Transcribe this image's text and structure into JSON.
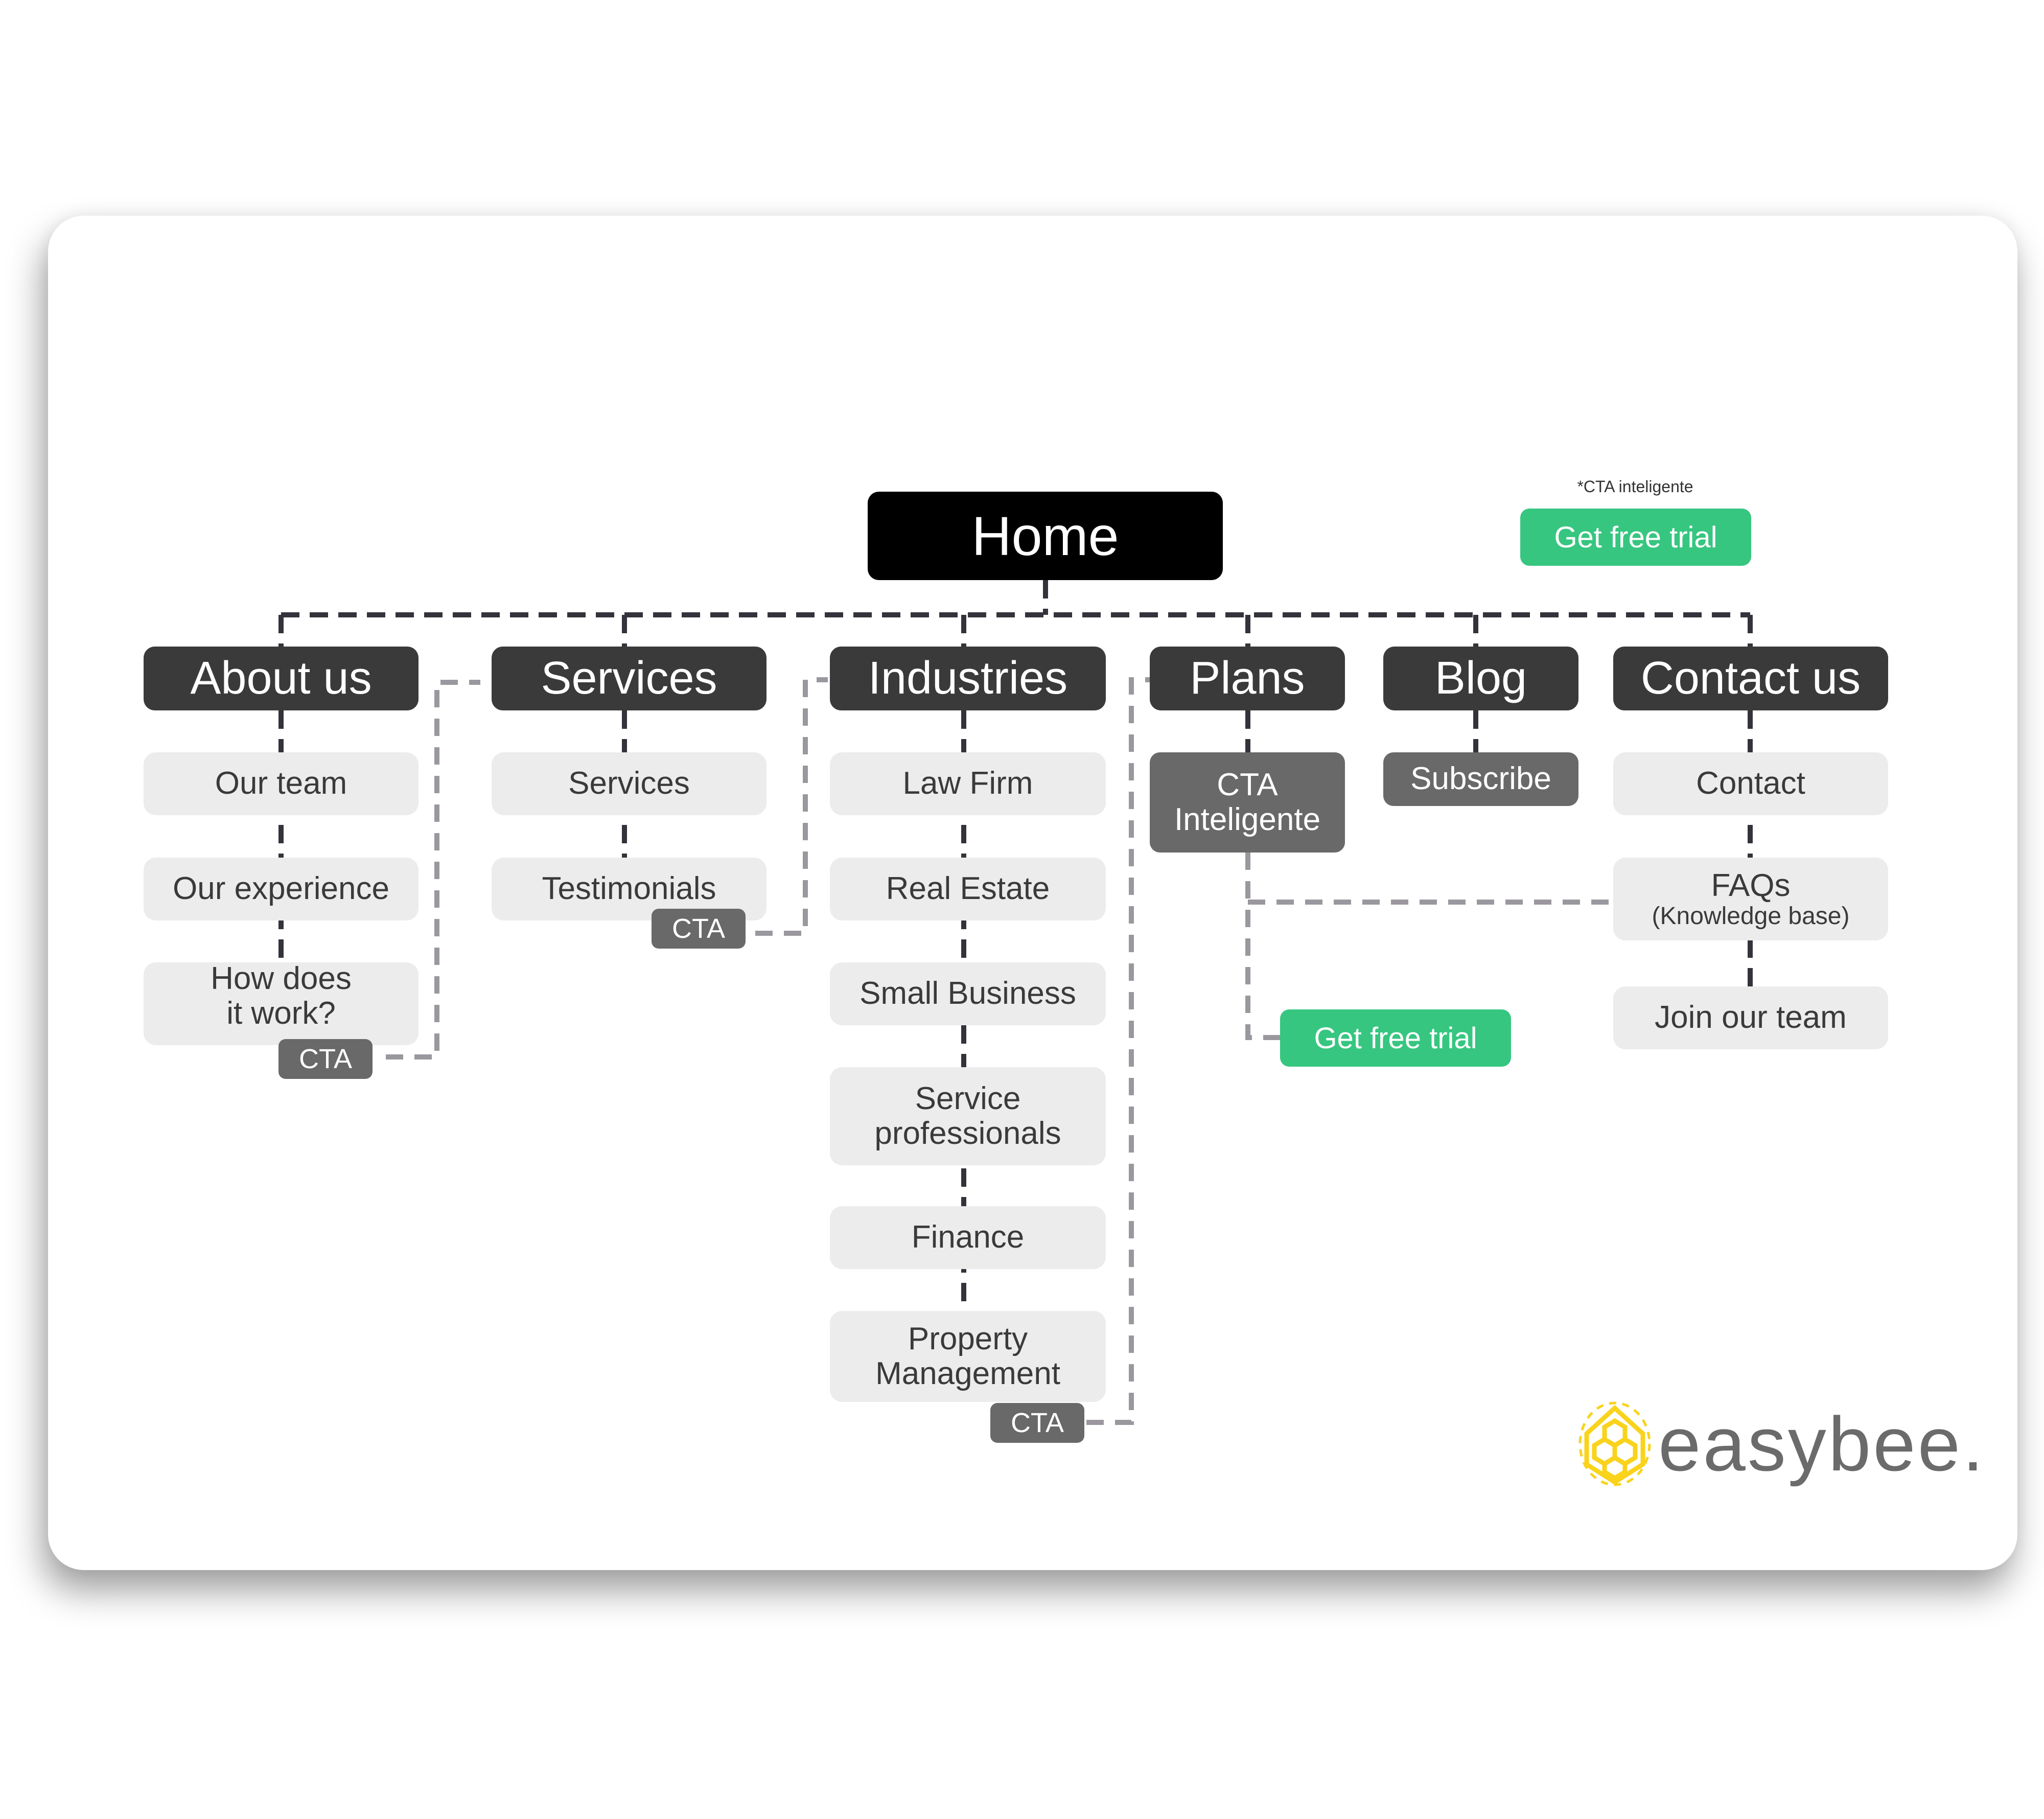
{
  "diagram": {
    "root": "Home",
    "legend": {
      "note": "*CTA inteligente",
      "button": "Get free trial"
    },
    "columns": [
      {
        "label": "About us",
        "children": [
          "Our team",
          "Our experience",
          "How does it work?"
        ],
        "cta": "CTA"
      },
      {
        "label": "Services",
        "children": [
          "Services",
          "Testimonials"
        ],
        "cta": "CTA"
      },
      {
        "label": "Industries",
        "children": [
          "Law Firm",
          "Real Estate",
          "Small Business",
          "Service professionals",
          "Finance",
          "Property Management"
        ],
        "cta": "CTA"
      },
      {
        "label": "Plans",
        "children": [
          "CTA Inteligente"
        ],
        "cta_button": "Get free trial"
      },
      {
        "label": "Blog",
        "children": [
          "Subscribe"
        ]
      },
      {
        "label": "Contact us",
        "children": [
          "Contact",
          "FAQs",
          "Join our team"
        ],
        "faq_sub": "(Knowledge base)"
      }
    ]
  },
  "brand": {
    "name": "easybee.",
    "icon": "honeycomb-icon",
    "colors": {
      "accent_green": "#36c680",
      "brand_yellow": "#f9d31c",
      "node_dark": "#3a3a3a",
      "node_light": "#ececec",
      "cta_gray": "#696969"
    }
  }
}
